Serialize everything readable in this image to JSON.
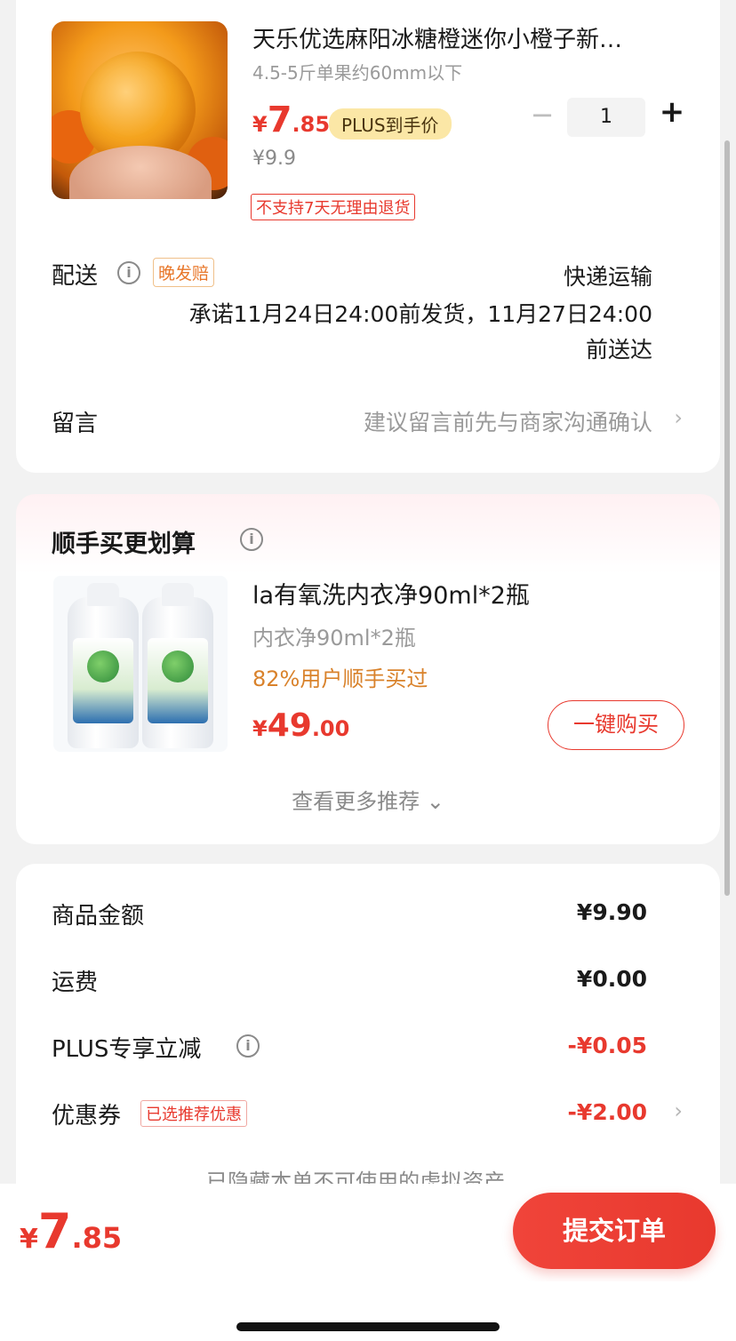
{
  "product": {
    "title": "天乐优选麻阳冰糖橙迷你小橙子新…",
    "spec": "4.5-5斤单果约60mm以下",
    "price_symbol": "¥",
    "price_int": "7",
    "price_dec": ".85",
    "plus_badge": "PLUS到手价",
    "original_price": "¥9.9",
    "return_tag": "不支持7天无理由退货",
    "quantity": "1",
    "qty_minus": "−",
    "qty_plus": "+"
  },
  "delivery": {
    "label": "配送",
    "info_icon": "i",
    "late_tag": "晚发赔",
    "method": "快递运输",
    "promise_line1": "承诺11月24日24:00前发货，11月27日24:00",
    "promise_line2": "前送达"
  },
  "message": {
    "label": "留言",
    "hint": "建议留言前先与商家沟通确认",
    "chevron": "›"
  },
  "recommendation": {
    "title": "顺手买更划算",
    "info_icon": "i",
    "item": {
      "name": "la有氧洗内衣净90ml*2瓶",
      "spec": "内衣净90ml*2瓶",
      "buyers": "82%用户顺手买过",
      "price_symbol": "¥",
      "price_int": "49",
      "price_dec": ".00",
      "buy_label": "一键购买"
    },
    "more_label": "查看更多推荐 ⌄"
  },
  "summary": {
    "rows": [
      {
        "label": "商品金额",
        "value": "¥9.90"
      },
      {
        "label": "运费",
        "value": "¥0.00"
      },
      {
        "label": "PLUS专享立减",
        "value": "-¥0.05"
      },
      {
        "label": "优惠券",
        "value": "-¥2.00",
        "tag": "已选推荐优惠"
      }
    ],
    "info_icon": "i",
    "chevron": "›",
    "hidden_note": "已隐藏本单不可使用的虚拟资产 ⌄"
  },
  "footer": {
    "total_symbol": "¥",
    "total_int": "7",
    "total_dec": ".85",
    "submit_label": "提交订单"
  },
  "colors": {
    "accent_red": "#e8392e",
    "plus_gold": "#fbe7a6",
    "orange_text": "#d9822b"
  },
  "icons": [
    "info-icon",
    "chevron-right-icon",
    "chevron-down-icon",
    "minus-icon",
    "plus-icon"
  ]
}
